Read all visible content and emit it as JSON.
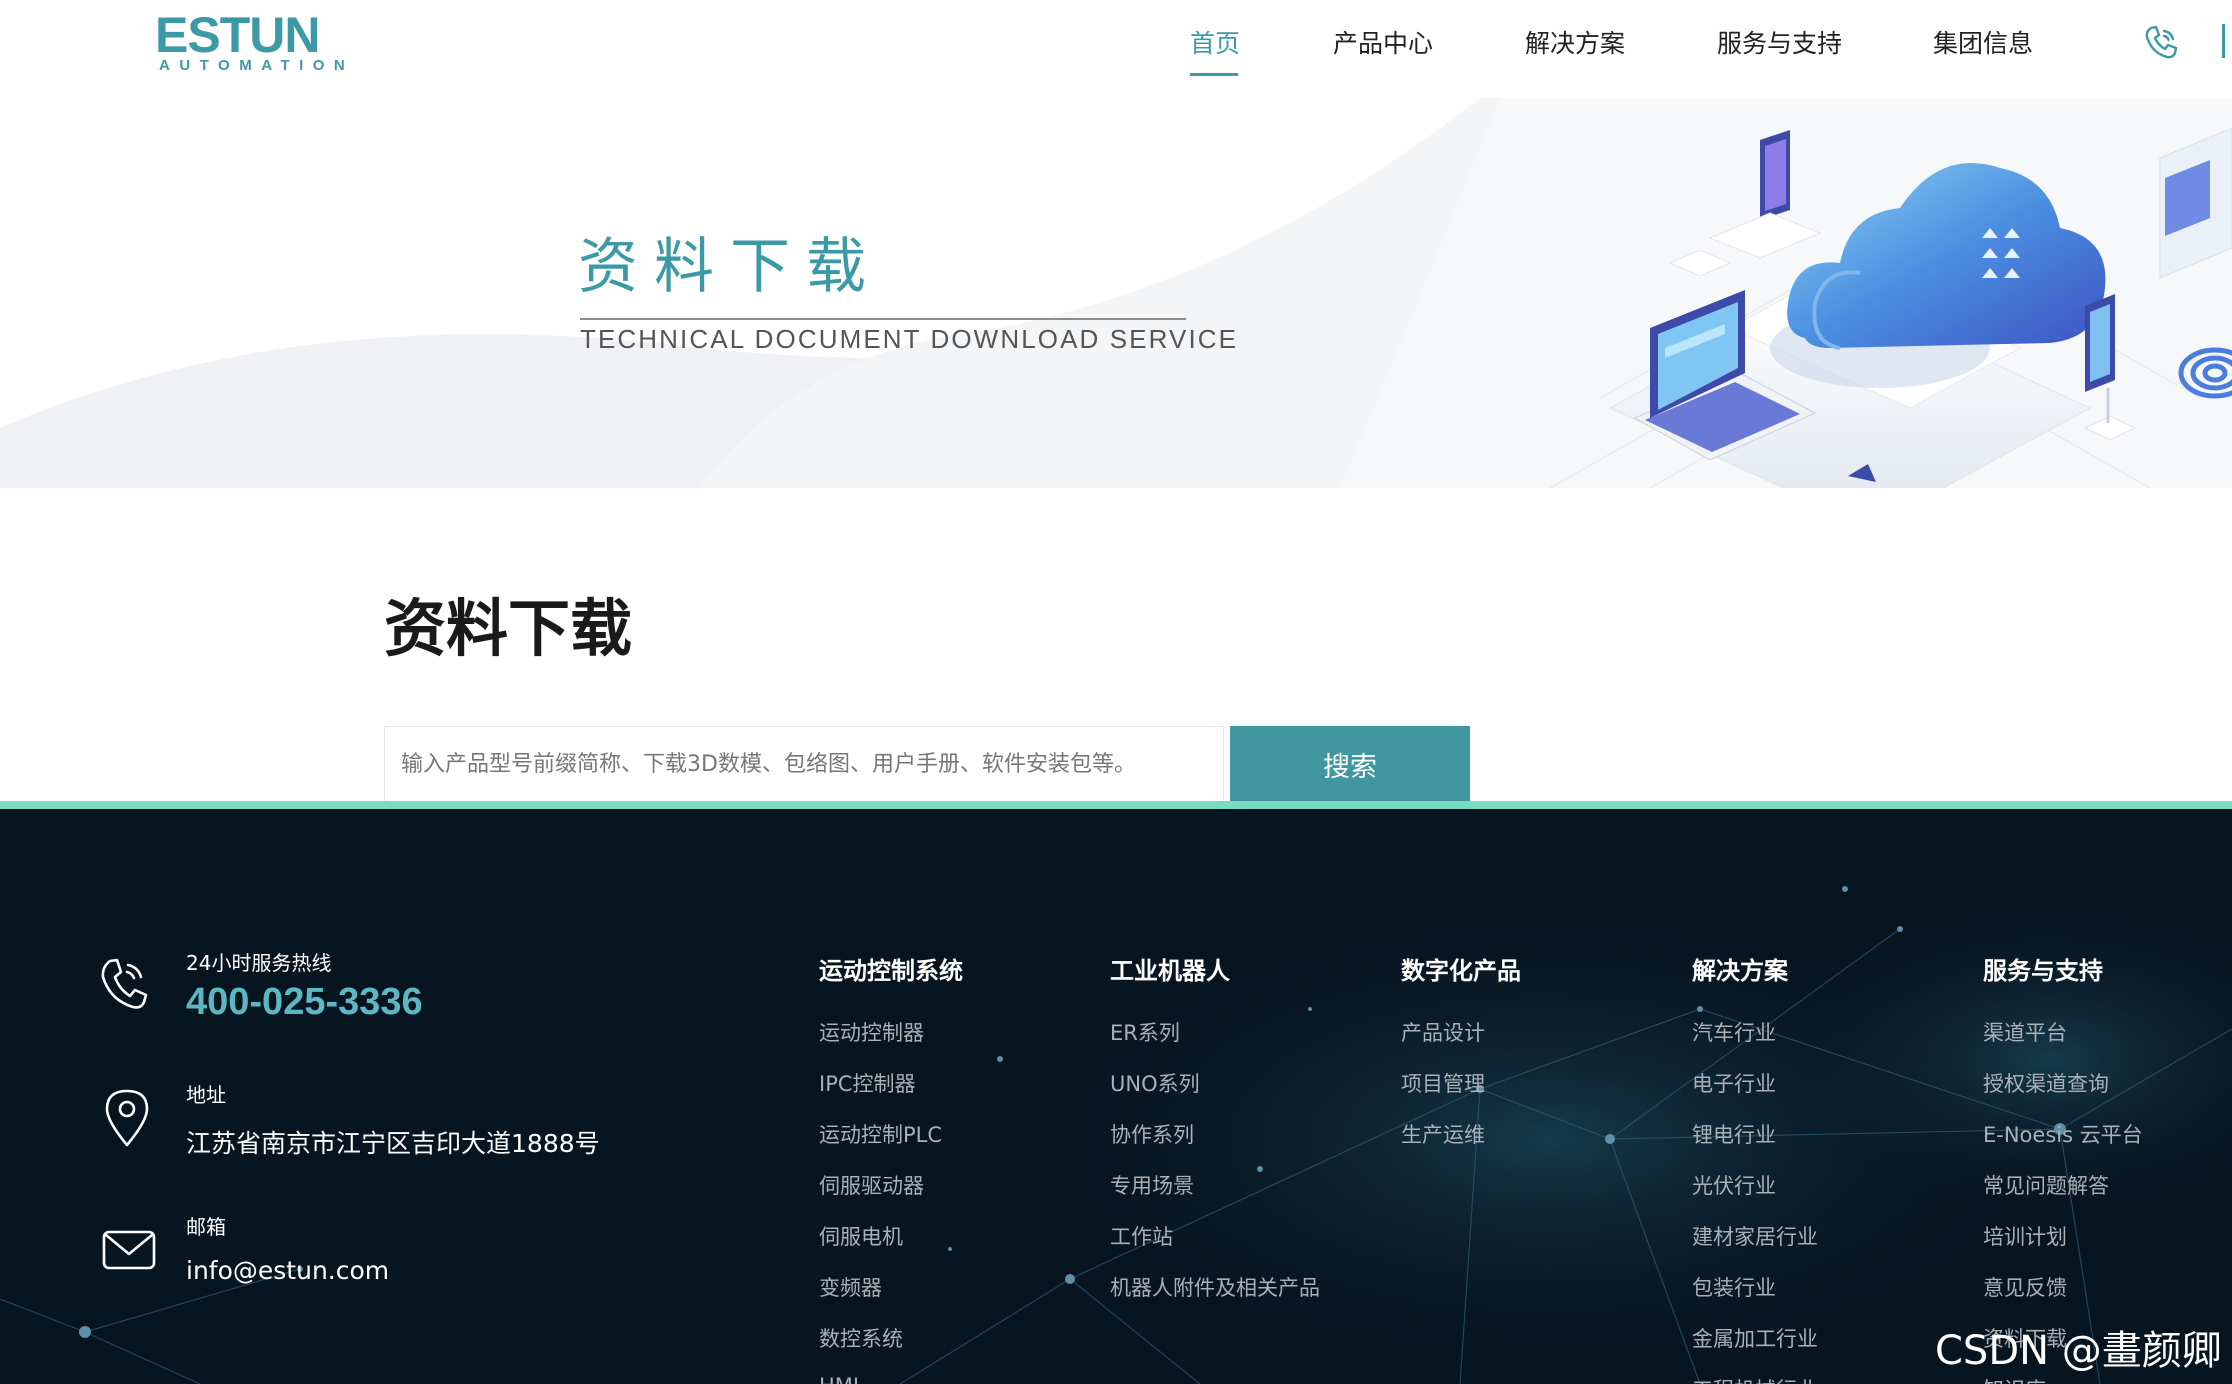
{
  "header": {
    "logo_main": "ESTUN",
    "logo_sub": "AUTOMATION",
    "nav": [
      {
        "label": "首页",
        "active": true
      },
      {
        "label": "产品中心",
        "active": false
      },
      {
        "label": "解决方案",
        "active": false
      },
      {
        "label": "服务与支持",
        "active": false
      },
      {
        "label": "集团信息",
        "active": false
      }
    ],
    "accent_color": "#3b9aa6"
  },
  "banner": {
    "title": "资料下载",
    "subtitle": "TECHNICAL DOCUMENT DOWNLOAD SERVICE"
  },
  "main": {
    "title": "资料下载",
    "search": {
      "placeholder": "输入产品型号前缀简称、下载3D数模、包络图、用户手册、软件安装包等。",
      "value": "",
      "button_label": "搜索"
    }
  },
  "footer": {
    "contacts": {
      "hotline_label": "24小时服务热线",
      "hotline_number": "400-025-3336",
      "address_label": "地址",
      "address_value": "江苏省南京市江宁区吉印大道1888号",
      "email_label": "邮箱",
      "email_value": "info@estun.com"
    },
    "columns": [
      {
        "heading": "运动控制系统",
        "links": [
          "运动控制器",
          "IPC控制器",
          "运动控制PLC",
          "伺服驱动器",
          "伺服电机",
          "变频器",
          "数控系统",
          "HMI"
        ]
      },
      {
        "heading": "工业机器人",
        "links": [
          "ER系列",
          "UNO系列",
          "协作系列",
          "专用场景",
          "工作站",
          "机器人附件及相关产品"
        ]
      },
      {
        "heading": "数字化产品",
        "links": [
          "产品设计",
          "项目管理",
          "生产运维"
        ]
      },
      {
        "heading": "解决方案",
        "links": [
          "汽车行业",
          "电子行业",
          "锂电行业",
          "光伏行业",
          "建材家居行业",
          "包装行业",
          "金属加工行业",
          "工程机械行业"
        ]
      },
      {
        "heading": "服务与支持",
        "links": [
          "渠道平台",
          "授权渠道查询",
          "E-Noesis 云平台",
          "常见问题解答",
          "培训计划",
          "意见反馈",
          "资料下载",
          "知识库"
        ]
      }
    ],
    "accent_color": "#79dcc0",
    "background_color": "#071521"
  },
  "watermark": "CSDN @畫颜卿"
}
